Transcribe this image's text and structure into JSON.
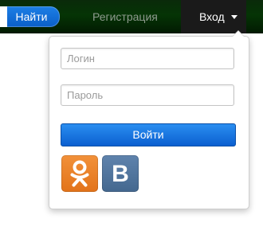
{
  "header": {
    "search_button_label": "Найти",
    "register_link_label": "Регистрация",
    "login_toggle_label": "Вход"
  },
  "login_dropdown": {
    "login_placeholder": "Логин",
    "password_placeholder": "Пароль",
    "submit_label": "Войти",
    "social": [
      {
        "name": "odnoklassniki",
        "icon": "odnoklassniki-icon",
        "color": "#ee8208"
      },
      {
        "name": "vkontakte",
        "icon": "vk-icon",
        "letter": "B",
        "color": "#4d72a0"
      }
    ]
  },
  "colors": {
    "topbar_bg": "#042a04",
    "accent_blue": "#0b5fd0",
    "register_link": "#8e9a8e",
    "login_toggle_bg": "#1a1a1a"
  }
}
